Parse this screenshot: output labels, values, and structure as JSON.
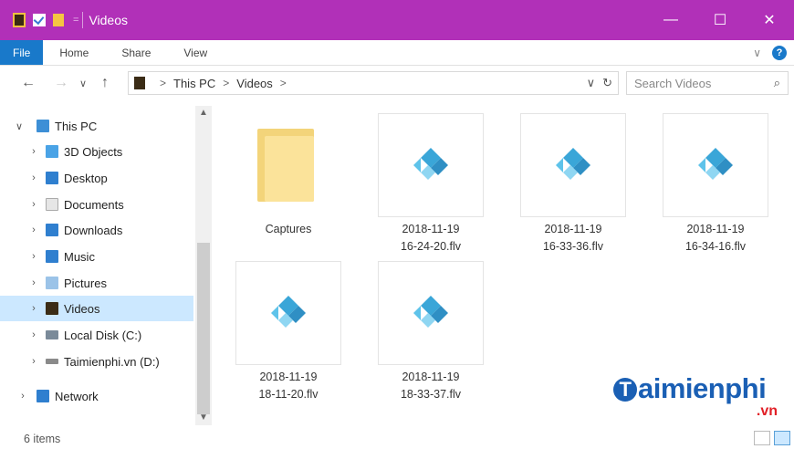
{
  "window": {
    "title": "Videos",
    "minimize": "—",
    "maximize": "☐",
    "close": "✕",
    "title_color": "#b130b8"
  },
  "ribbon": {
    "tabs": [
      "File",
      "Home",
      "Share",
      "View"
    ],
    "file_color": "#1979ca",
    "expand_glyph": "∨",
    "help_glyph": "?"
  },
  "nav": {
    "back": "←",
    "forward": "→",
    "recent": "∨",
    "up": "↑"
  },
  "address": {
    "crumbs": [
      "This PC",
      "Videos"
    ],
    "dropdown": "∨",
    "refresh": "↻"
  },
  "search": {
    "placeholder": "Search Videos",
    "icon": "search-icon"
  },
  "tree": [
    {
      "label": "This PC",
      "arrow": "∨",
      "icon": "pc-icon",
      "color": "#3d8fd6"
    },
    {
      "label": "3D Objects",
      "arrow": "›",
      "icon": "3d-objects-icon",
      "color": "#4aa3e6"
    },
    {
      "label": "Desktop",
      "arrow": "›",
      "icon": "desktop-icon",
      "color": "#2f7fcf"
    },
    {
      "label": "Documents",
      "arrow": "›",
      "icon": "documents-icon",
      "color": "#c9c9c9"
    },
    {
      "label": "Downloads",
      "arrow": "›",
      "icon": "downloads-icon",
      "color": "#2f7fcf"
    },
    {
      "label": "Music",
      "arrow": "›",
      "icon": "music-icon",
      "color": "#2f7fcf"
    },
    {
      "label": "Pictures",
      "arrow": "›",
      "icon": "pictures-icon",
      "color": "#9bc3e8"
    },
    {
      "label": "Videos",
      "arrow": "›",
      "icon": "videos-icon",
      "color": "#3b2c16"
    },
    {
      "label": "Local Disk (C:)",
      "arrow": "›",
      "icon": "local-disk-icon",
      "color": "#7a8a99"
    },
    {
      "label": "Taimienphi.vn (D:)",
      "arrow": "›",
      "icon": "drive-icon",
      "color": "#8a8a8a"
    },
    {
      "label": "Network",
      "arrow": "›",
      "icon": "network-icon",
      "color": "#2f7fcf"
    }
  ],
  "files": [
    {
      "label": "Captures",
      "type": "folder"
    },
    {
      "label": "2018-11-19\n16-24-20.flv",
      "type": "video"
    },
    {
      "label": "2018-11-19\n16-33-36.flv",
      "type": "video"
    },
    {
      "label": "2018-11-19\n16-34-16.flv",
      "type": "video"
    },
    {
      "label": "2018-11-19\n18-11-20.flv",
      "type": "video"
    },
    {
      "label": "2018-11-19\n18-33-37.flv",
      "type": "video"
    }
  ],
  "status": {
    "count": "6 items"
  },
  "watermark": {
    "brand": "aimienphi",
    "initial": "T",
    "suffix": ".vn"
  }
}
